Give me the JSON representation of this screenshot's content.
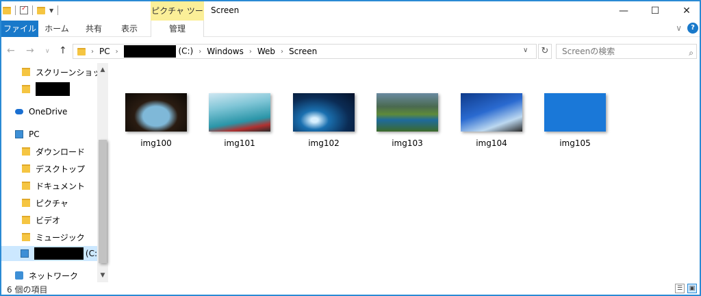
{
  "titlebar": {
    "context_tab": "ピクチャ ツール",
    "title": "Screen",
    "minimize_icon": "minimize-icon",
    "maximize_icon": "maximize-icon",
    "close_icon": "close-icon"
  },
  "ribbon": {
    "tabs": [
      "ファイル",
      "ホーム",
      "共有",
      "表示",
      "管理"
    ]
  },
  "address": {
    "crumbs": [
      "PC",
      "(C:)",
      "Windows",
      "Web",
      "Screen"
    ],
    "search_placeholder": "Screenの検索"
  },
  "navpane": {
    "items": [
      {
        "label": "スクリーンショット",
        "icon": "folder-icon"
      },
      {
        "label": "",
        "icon": "folder-icon"
      },
      {
        "label": "OneDrive",
        "icon": "onedrive-icon"
      },
      {
        "label": "PC",
        "icon": "pc-icon"
      },
      {
        "label": "ダウンロード",
        "icon": "downloads-folder-icon"
      },
      {
        "label": "デスクトップ",
        "icon": "desktop-folder-icon"
      },
      {
        "label": "ドキュメント",
        "icon": "documents-folder-icon"
      },
      {
        "label": "ピクチャ",
        "icon": "pictures-folder-icon"
      },
      {
        "label": "ビデオ",
        "icon": "videos-folder-icon"
      },
      {
        "label": "ミュージック",
        "icon": "music-folder-icon"
      },
      {
        "label": "(C:",
        "icon": "drive-icon"
      },
      {
        "label": "ネットワーク",
        "icon": "network-icon"
      }
    ]
  },
  "files": [
    {
      "name": "img100"
    },
    {
      "name": "img101"
    },
    {
      "name": "img102"
    },
    {
      "name": "img103"
    },
    {
      "name": "img104"
    },
    {
      "name": "img105"
    }
  ],
  "status": {
    "count_text": "6 個の項目"
  },
  "colors": {
    "accent": "#1979ca",
    "border": "#2a8ad4",
    "context_tab": "#fbef98",
    "selected": "#cce8ff"
  }
}
